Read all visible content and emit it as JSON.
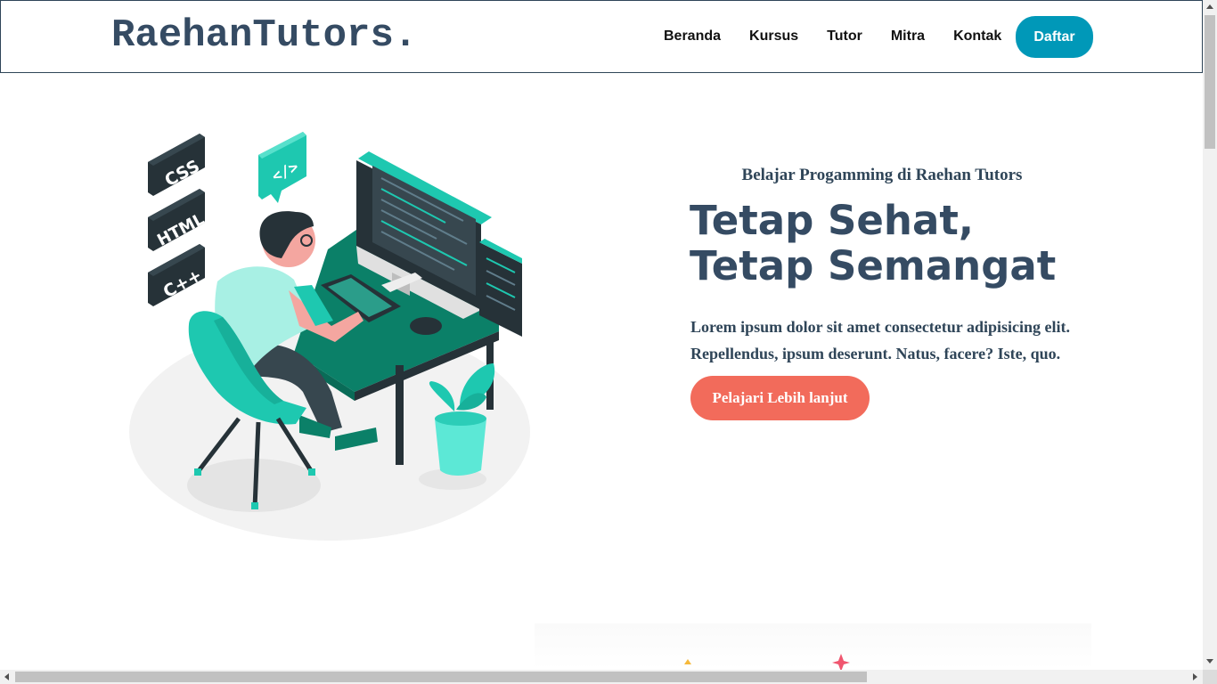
{
  "header": {
    "logo": "RaehanTutors.",
    "nav": [
      "Beranda",
      "Kursus",
      "Tutor",
      "Mitra",
      "Kontak"
    ],
    "signup_label": "Daftar"
  },
  "hero": {
    "subtitle": "Belajar Progamming di Raehan Tutors",
    "title": "Tetap Sehat, Tetap Semangat",
    "text": "Lorem ipsum dolor sit amet consectetur adipisicing elit. Repellendus, ipsum deserunt. Natus, facere? Iste, quo.",
    "cta_label": "Pelajari Lebih lanjut",
    "illustration": {
      "badges": [
        "CSS",
        "HTML",
        "C++"
      ],
      "bubble_text": "</>"
    }
  },
  "colors": {
    "brand_dark": "#354b63",
    "signup": "#0098b8",
    "cta": "#f26b5b",
    "accent_teal": "#1ec8b0"
  },
  "icons": [
    "code-bubble-icon",
    "scroll-up-arrow-icon",
    "scroll-down-arrow-icon",
    "scroll-left-arrow-icon",
    "scroll-right-arrow-icon"
  ]
}
